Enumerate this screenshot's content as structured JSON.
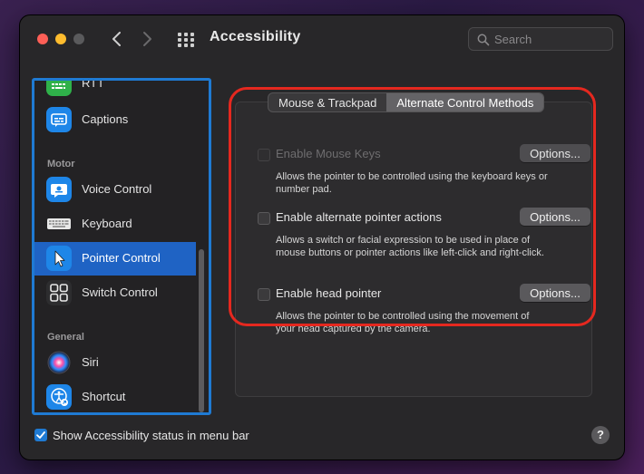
{
  "window": {
    "title": "Accessibility"
  },
  "search": {
    "placeholder": "Search"
  },
  "sidebar": {
    "sections": {
      "motor": "Motor",
      "general": "General"
    },
    "items": [
      {
        "label": "RTT",
        "icon": "rtt-icon"
      },
      {
        "label": "Captions",
        "icon": "captions-icon"
      },
      {
        "label": "Voice Control",
        "icon": "voice-control-icon"
      },
      {
        "label": "Keyboard",
        "icon": "keyboard-icon"
      },
      {
        "label": "Pointer Control",
        "icon": "pointer-control-icon",
        "selected": true
      },
      {
        "label": "Switch Control",
        "icon": "switch-control-icon"
      },
      {
        "label": "Siri",
        "icon": "siri-icon"
      },
      {
        "label": "Shortcut",
        "icon": "accessibility-shortcut-icon"
      }
    ]
  },
  "tabs": [
    {
      "label": "Mouse & Trackpad",
      "active": false
    },
    {
      "label": "Alternate Control Methods",
      "active": true
    }
  ],
  "options": [
    {
      "label": "Enable Mouse Keys",
      "description": "Allows the pointer to be controlled using the keyboard keys or number pad.",
      "button": "Options...",
      "checked": false,
      "disabled": true
    },
    {
      "label": "Enable alternate pointer actions",
      "description": "Allows a switch or facial expression to be used in place of mouse buttons or pointer actions like left-click and right-click.",
      "button": "Options...",
      "checked": false,
      "disabled": false
    },
    {
      "label": "Enable head pointer",
      "description": "Allows the pointer to be controlled using the movement of your head captured by the camera.",
      "button": "Options...",
      "checked": false,
      "disabled": false
    }
  ],
  "footer": {
    "status_label": "Show Accessibility status in menu bar",
    "status_checked": true,
    "help_label": "?"
  },
  "colors": {
    "accent": "#1f63c4",
    "highlight": "#e5281f"
  }
}
